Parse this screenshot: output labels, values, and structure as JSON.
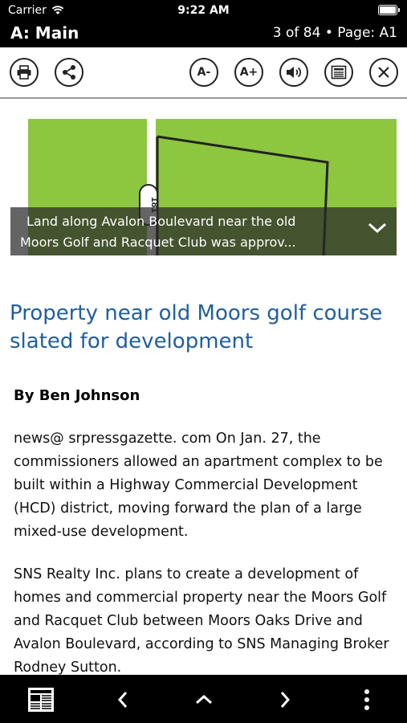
{
  "status": {
    "carrier": "Carrier",
    "time": "9:22 AM",
    "battery_level": 1.0
  },
  "header": {
    "section_title": "A: Main",
    "page_indicator": "3 of 84 • Page: A1"
  },
  "toolbar": {
    "decrease_font_label": "A-",
    "increase_font_label": "A+"
  },
  "hero_image": {
    "road_marker": "181",
    "caption_line1": "Land along Avalon Boulevard near the old",
    "caption_line2": "Moors Golf and Racquet Club was approv..."
  },
  "article": {
    "headline": "Property near old Moors golf course slated for development",
    "byline": "By Ben Johnson",
    "paragraphs": [
      "news@ srpressgazette. com On Jan. 27, the commissioners allowed an apartment complex to be built within a Highway Commercial Development (HCD) district, moving forward the plan of a large mixed-use development.",
      "SNS Realty Inc. plans to create a development of homes and commercial property near the Moors Golf and Racquet Club between Moors Oaks Drive and Avalon Boulevard, according to SNS Managing Broker Rodney Sutton."
    ]
  },
  "colors": {
    "headline": "#1f5f9e",
    "map_green": "#8dc63f",
    "bars": "#000000"
  }
}
